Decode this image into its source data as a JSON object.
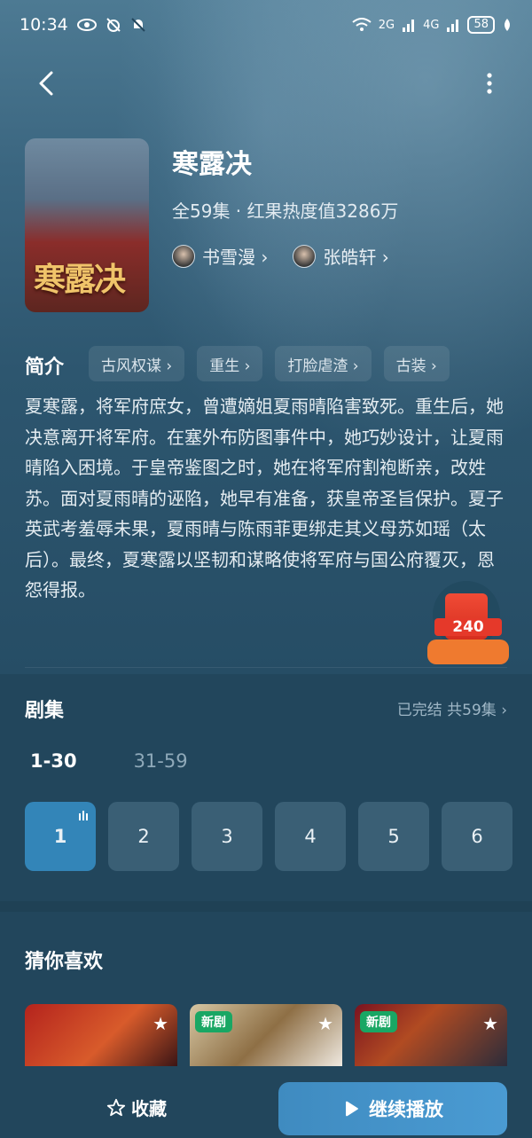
{
  "status_bar": {
    "time": "10:34",
    "signal1": "2G",
    "signal2": "4G",
    "battery": "58"
  },
  "show": {
    "title": "寒露决",
    "meta": "全59集 · 红果热度值3286万",
    "poster_title": "寒露决",
    "cast": [
      {
        "name": "书雪漫 ›"
      },
      {
        "name": "张皓轩 ›"
      }
    ]
  },
  "intro": {
    "label": "简介",
    "tags": [
      "古风权谋 ›",
      "重生 ›",
      "打脸虐渣 ›",
      "古装 ›"
    ],
    "summary": "夏寒露，将军府庶女，曾遭嫡姐夏雨晴陷害致死。重生后，她决意离开将军府。在塞外布防图事件中，她巧妙设计，让夏雨晴陷入困境。于皇帝鉴图之时，她在将军府割袍断亲，改姓苏。面对夏雨晴的诬陷，她早有准备，获皇帝圣旨保护。夏子英武考羞辱未果，夏雨晴与陈雨菲更绑走其义母苏如瑶（太后）。最终，夏寒露以坚韧和谋略使将军府与国公府覆灭，恩怨得报。"
  },
  "red_packet": {
    "value": "240"
  },
  "episodes": {
    "title": "剧集",
    "status": "已完结 共59集 ›",
    "ranges": [
      "1-30",
      "31-59"
    ],
    "items": [
      "1",
      "2",
      "3",
      "4",
      "5",
      "6"
    ]
  },
  "recommend": {
    "title": "猜你喜欢",
    "cards": [
      {
        "badge": ""
      },
      {
        "badge": "新剧"
      },
      {
        "badge": "新剧"
      }
    ]
  },
  "bottom": {
    "favorite": "收藏",
    "play": "继续播放"
  }
}
